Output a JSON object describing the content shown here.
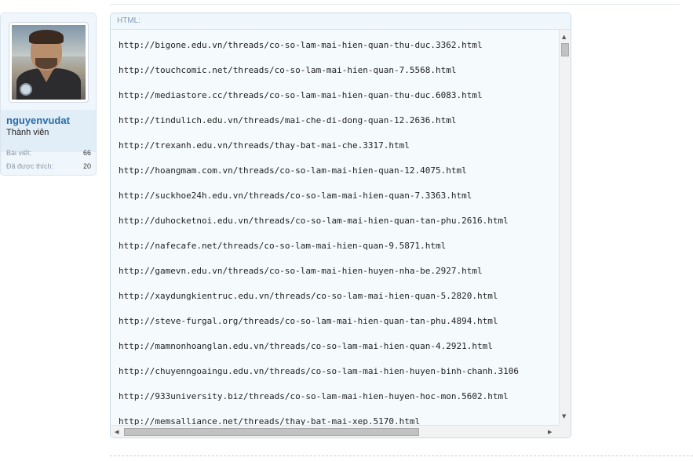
{
  "user": {
    "name": "nguyenvudat",
    "title": "Thành viên",
    "stats": [
      {
        "label": "Bài viết:",
        "value": "66"
      },
      {
        "label": "Đã được thích:",
        "value": "20"
      }
    ]
  },
  "code_block": {
    "header": "HTML:",
    "lines": [
      "http://bigone.edu.vn/threads/co-so-lam-mai-hien-quan-thu-duc.3362.html",
      "http://touchcomic.net/threads/co-so-lam-mai-hien-quan-7.5568.html",
      "http://mediastore.cc/threads/co-so-lam-mai-hien-quan-thu-duc.6083.html",
      "http://tindulich.edu.vn/threads/mai-che-di-dong-quan-12.2636.html",
      "http://trexanh.edu.vn/threads/thay-bat-mai-che.3317.html",
      "http://hoangmam.com.vn/threads/co-so-lam-mai-hien-quan-12.4075.html",
      "http://suckhoe24h.edu.vn/threads/co-so-lam-mai-hien-quan-7.3363.html",
      "http://duhocketnoi.edu.vn/threads/co-so-lam-mai-hien-quan-tan-phu.2616.html",
      "http://nafecafe.net/threads/co-so-lam-mai-hien-quan-9.5871.html",
      "http://gamevn.edu.vn/threads/co-so-lam-mai-hien-huyen-nha-be.2927.html",
      "http://xaydungkientruc.edu.vn/threads/co-so-lam-mai-hien-quan-5.2820.html",
      "http://steve-furgal.org/threads/co-so-lam-mai-hien-quan-tan-phu.4894.html",
      "http://mamnonhoanglan.edu.vn/threads/co-so-lam-mai-hien-quan-4.2921.html",
      "http://chuyenngoaingu.edu.vn/threads/co-so-lam-mai-hien-huyen-binh-chanh.3106",
      "http://933university.biz/threads/co-so-lam-mai-hien-huyen-hoc-mon.5602.html",
      "http://memsalliance.net/threads/thay-bat-mai-xep.5170.html"
    ]
  },
  "icons": {
    "scroll_up": "scroll-up-arrow-icon",
    "scroll_down": "scroll-down-arrow-icon",
    "scroll_left": "scroll-left-arrow-icon",
    "scroll_right": "scroll-right-arrow-icon"
  },
  "colors": {
    "username": "#2b6ba3",
    "sidebar_bg": "#f0f7fc",
    "code_bg": "#f5fafd",
    "code_header_text": "#7f9bb4"
  }
}
